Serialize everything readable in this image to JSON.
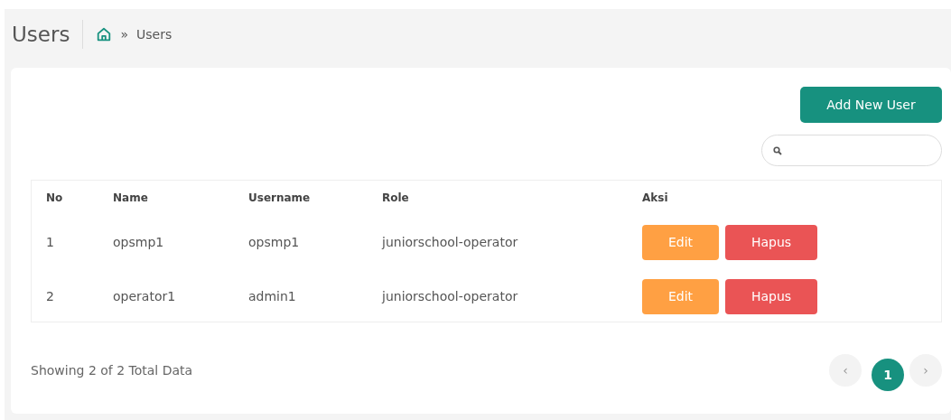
{
  "header": {
    "title": "Users",
    "breadcrumb": "Users",
    "separator": "»"
  },
  "add_button": "Add New User",
  "table": {
    "columns": [
      "No",
      "Name",
      "Username",
      "Role",
      "Aksi"
    ],
    "rows": [
      {
        "no": "1",
        "name": "opsmp1",
        "username": "opsmp1",
        "role": "juniorschool-operator",
        "actions": [
          "Edit",
          "Hapus"
        ]
      },
      {
        "no": "2",
        "name": "operator1",
        "username": "admin1",
        "role": "juniorschool-operator",
        "actions": [
          "Edit",
          "Hapus"
        ]
      }
    ]
  },
  "footer": "Showing 2 of 2 Total Data",
  "pagination": [
    {
      "label": "‹",
      "kind": "prev",
      "selected": false
    },
    {
      "label": "1",
      "kind": "page",
      "selected": true
    },
    {
      "label": "›",
      "kind": "next",
      "selected": false
    }
  ]
}
